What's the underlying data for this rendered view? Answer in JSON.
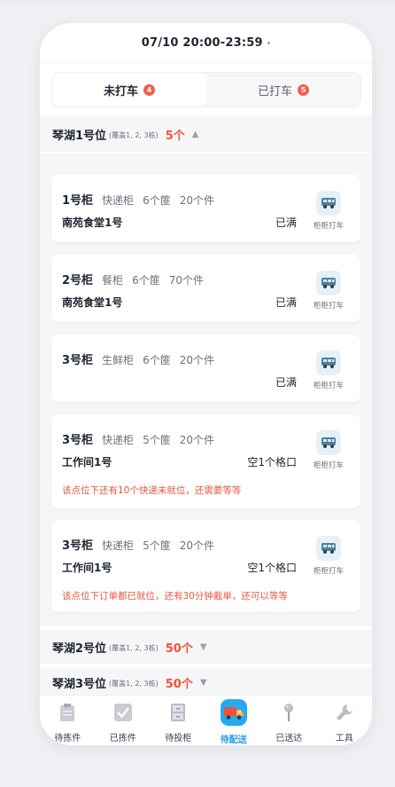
{
  "header": {
    "time_range": "07/10 20:00-23:59",
    "caret": "▾"
  },
  "tabs": [
    {
      "label": "未打车",
      "badge": "4",
      "active": true
    },
    {
      "label": "已打车",
      "badge": "5",
      "active": false
    }
  ],
  "groups": [
    {
      "title": "琴湖1号位",
      "coverage": "(覆盖1, 2, 3栋)",
      "count": "5个",
      "arrow": "▲",
      "expanded": true
    },
    {
      "title": "琴湖2号位",
      "coverage": "(覆盖1, 2, 3栋)",
      "count": "50个",
      "arrow": "▼",
      "expanded": false
    },
    {
      "title": "琴湖3号位",
      "coverage": "(覆盖1, 2, 3栋)",
      "count": "50个",
      "arrow": "▼",
      "expanded": false
    }
  ],
  "cabinets": [
    {
      "name": "1号柜",
      "type": "快递柜",
      "slots": "6个篚",
      "items": "20个件",
      "location": "南苑食堂1号",
      "status": "已满",
      "note": "",
      "action": "柜柜打车"
    },
    {
      "name": "2号柜",
      "type": "餐柜",
      "slots": "6个篚",
      "items": "70个件",
      "location": "南苑食堂1号",
      "status": "已满",
      "note": "",
      "action": "柜柜打车"
    },
    {
      "name": "3号柜",
      "type": "生鲜柜",
      "slots": "6个篚",
      "items": "20个件",
      "location": "",
      "status": "已满",
      "note": "",
      "action": "柜柜打车"
    },
    {
      "name": "3号柜",
      "type": "快递柜",
      "slots": "5个篚",
      "items": "20个件",
      "location": "工作间1号",
      "status": "空1个格口",
      "note": "该点位下还有10个快递未就位，还需要等等",
      "action": "柜柜打车"
    },
    {
      "name": "3号柜",
      "type": "快递柜",
      "slots": "5个篚",
      "items": "20个件",
      "location": "工作间1号",
      "status": "空1个格口",
      "note": "该点位下订单都已就位，还有30分钟截单，还可以等等",
      "action": "柜柜打车"
    }
  ],
  "tabbar": [
    {
      "label": "待拣件",
      "icon": "clipboard-icon",
      "active": false
    },
    {
      "label": "已拣件",
      "icon": "checkbox-icon",
      "active": false
    },
    {
      "label": "待投柜",
      "icon": "cabinet-icon",
      "active": false
    },
    {
      "label": "待配送",
      "icon": "delivery-truck-icon",
      "active": true
    },
    {
      "label": "已送达",
      "icon": "pin-icon",
      "active": false
    },
    {
      "label": "工具",
      "icon": "wrench-icon",
      "active": false
    }
  ],
  "colors": {
    "accent_red": "#f0523b",
    "active_blue": "#27a9f0",
    "note_red": "#e8553e"
  }
}
